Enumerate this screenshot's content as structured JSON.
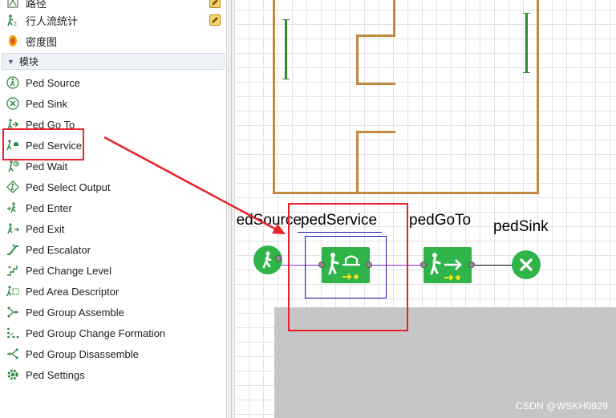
{
  "palette": {
    "top_items": [
      {
        "label": "路径",
        "icon": "path-icon",
        "editable": true
      },
      {
        "label": "行人流统计",
        "icon": "ped-flow-statistics-icon",
        "editable": true
      },
      {
        "label": "密度图",
        "icon": "density-map-icon",
        "editable": false
      }
    ],
    "section_label": "模块",
    "items": [
      {
        "label": "Ped Source",
        "icon": "ped-source-icon"
      },
      {
        "label": "Ped Sink",
        "icon": "ped-sink-icon"
      },
      {
        "label": "Ped Go To",
        "icon": "ped-go-to-icon"
      },
      {
        "label": "Ped Service",
        "icon": "ped-service-icon"
      },
      {
        "label": "Ped Wait",
        "icon": "ped-wait-icon"
      },
      {
        "label": "Ped Select Output",
        "icon": "ped-select-output-icon"
      },
      {
        "label": "Ped Enter",
        "icon": "ped-enter-icon"
      },
      {
        "label": "Ped Exit",
        "icon": "ped-exit-icon"
      },
      {
        "label": "Ped Escalator",
        "icon": "ped-escalator-icon"
      },
      {
        "label": "Ped Change Level",
        "icon": "ped-change-level-icon"
      },
      {
        "label": "Ped Area Descriptor",
        "icon": "ped-area-descriptor-icon"
      },
      {
        "label": "Ped Group Assemble",
        "icon": "ped-group-assemble-icon"
      },
      {
        "label": "Ped Group Change Formation",
        "icon": "ped-group-change-formation-icon"
      },
      {
        "label": "Ped Group Disassemble",
        "icon": "ped-group-disassemble-icon"
      },
      {
        "label": "Ped Settings",
        "icon": "ped-settings-icon"
      }
    ]
  },
  "canvas": {
    "blocks": {
      "source": {
        "label": "pedSource"
      },
      "service": {
        "label": "pedService"
      },
      "goto": {
        "label": "pedGoTo"
      },
      "sink": {
        "label": "pedSink"
      }
    },
    "watermark": "CSDN @WSKH0929"
  },
  "colors": {
    "block_green": "#2fb44a",
    "wall": "#c4883e",
    "highlight_red": "#e8222a",
    "selection_blue": "#1a1aaa"
  }
}
